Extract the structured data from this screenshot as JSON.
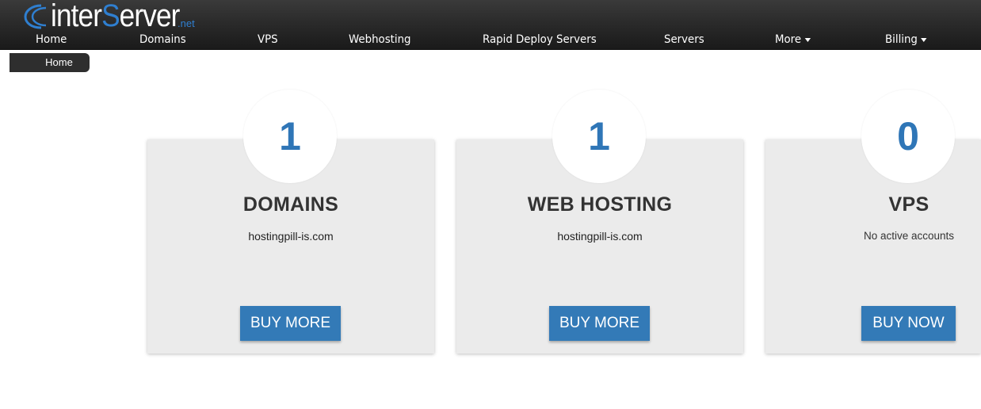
{
  "brand": {
    "logo_main_prefix": "inter",
    "logo_main_accent": "S",
    "logo_main_suffix": "erver",
    "logo_tld": ".net"
  },
  "nav": {
    "items": [
      {
        "label": "Home",
        "dropdown": false
      },
      {
        "label": "Domains",
        "dropdown": false
      },
      {
        "label": "VPS",
        "dropdown": false
      },
      {
        "label": "Webhosting",
        "dropdown": false
      },
      {
        "label": "Rapid Deploy Servers",
        "dropdown": false
      },
      {
        "label": "Servers",
        "dropdown": false
      },
      {
        "label": "More",
        "dropdown": true
      },
      {
        "label": "Billing",
        "dropdown": true
      }
    ]
  },
  "breadcrumb": {
    "current": "Home"
  },
  "cards": [
    {
      "count": "1",
      "title": "DOMAINS",
      "subtitle": "hostingpill-is.com",
      "button": "BUY MORE"
    },
    {
      "count": "1",
      "title": "WEB HOSTING",
      "subtitle": "hostingpill-is.com",
      "button": "BUY MORE"
    },
    {
      "count": "0",
      "title": "VPS",
      "subtitle": "No active accounts",
      "button": "BUY NOW"
    }
  ],
  "colors": {
    "accent": "#337ab7",
    "count_text": "#2f76b7",
    "topbar": "#2b2b2b",
    "card_bg": "#ebebeb"
  }
}
